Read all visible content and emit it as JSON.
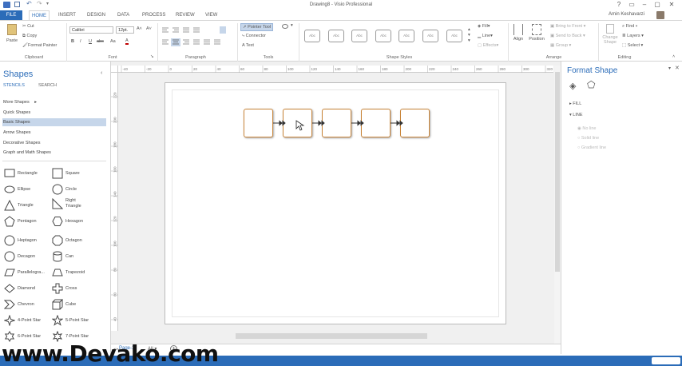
{
  "window": {
    "title": "Drawing8 - Visio Professional",
    "user": "Amin Keshavarzi"
  },
  "tabs": [
    "FILE",
    "HOME",
    "INSERT",
    "DESIGN",
    "DATA",
    "PROCESS",
    "REVIEW",
    "VIEW"
  ],
  "ribbon": {
    "clipboard": {
      "paste": "Paste",
      "cut": "Cut",
      "copy": "Copy",
      "format_painter": "Format Painter",
      "label": "Clipboard"
    },
    "font": {
      "family": "Calibri",
      "size": "12pt.",
      "label": "Font",
      "bold": "B",
      "italic": "I",
      "underline": "U",
      "strike": "abc",
      "aa": "Aa",
      "font_color": "A"
    },
    "paragraph": {
      "label": "Paragraph"
    },
    "tools": {
      "pointer": "Pointer Tool",
      "connector": "Connector",
      "text": "Text",
      "label": "Tools"
    },
    "shape_styles": {
      "sample": "Abc",
      "label": "Shape Styles",
      "fill": "Fill",
      "line": "Line",
      "effects": "Effects"
    },
    "arrange": {
      "align": "Align",
      "position": "Position",
      "bring_to_front": "Bring to Front",
      "send_to_back": "Send to Back",
      "group": "Group",
      "label": "Arrange"
    },
    "editing": {
      "change_shape": "Change Shape",
      "find": "Find",
      "layers": "Layers",
      "select": "Select",
      "label": "Editing"
    }
  },
  "shapes_panel": {
    "title": "Shapes",
    "tab_stencils": "STENCILS",
    "tab_search": "SEARCH",
    "categories": [
      "More Shapes",
      "Quick Shapes",
      "Basic Shapes",
      "Arrow Shapes",
      "Decorative Shapes",
      "Graph and Math Shapes"
    ],
    "selected": "Basic Shapes",
    "stencils": [
      "Rectangle",
      "Square",
      "Ellipse",
      "Circle",
      "Triangle",
      "Right Triangle",
      "Pentagon",
      "Hexagon",
      "Heptagon",
      "Octagon",
      "Decagon",
      "Can",
      "Parallelogra...",
      "Trapezoid",
      "Diamond",
      "Cross",
      "Chevron",
      "Cube",
      "4-Point Star",
      "5-Point Star",
      "6-Point Star",
      "7-Point Star"
    ]
  },
  "ruler": {
    "h_ticks": [
      "-40",
      "-20",
      "0",
      "20",
      "40",
      "60",
      "80",
      "100",
      "120",
      "140",
      "160",
      "180",
      "200",
      "220",
      "240",
      "260",
      "280",
      "300",
      "320"
    ],
    "v_ticks": [
      "220",
      "200",
      "180",
      "160",
      "140",
      "120",
      "100",
      "80",
      "60",
      "40"
    ]
  },
  "format_panel": {
    "title": "Format Shape",
    "fill": "FILL",
    "line": "LINE",
    "no_line": "No line",
    "solid_line": "Solid line",
    "gradient_line": "Gradient line"
  },
  "pagebar": {
    "page": "Page-1",
    "all": "All"
  },
  "watermark": "www.Devako.com",
  "colors": {
    "accent": "#2b6cb8",
    "shape_border": "#c9853a",
    "selected_category": "#c6d6ea"
  }
}
